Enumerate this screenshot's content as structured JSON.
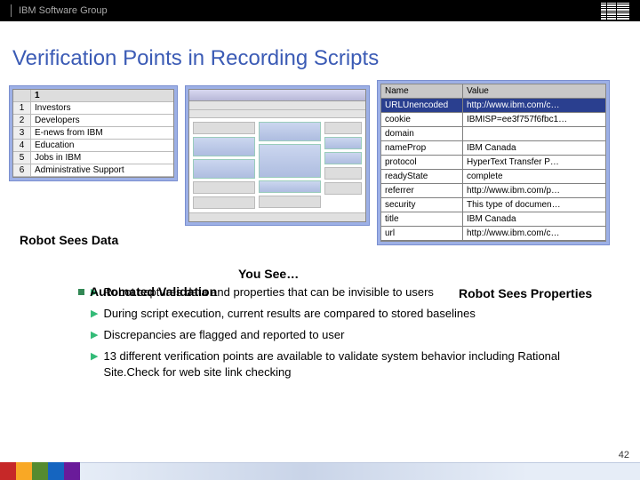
{
  "header": {
    "group": "IBM Software Group"
  },
  "title": "Verification Points in Recording Scripts",
  "captions": {
    "left": "Robot Sees Data",
    "mid": "You See…",
    "right": "Robot Sees Properties"
  },
  "sheet": {
    "head": "1",
    "rows": [
      {
        "n": "1",
        "v": "Investors"
      },
      {
        "n": "2",
        "v": "Developers"
      },
      {
        "n": "3",
        "v": "E-news from IBM"
      },
      {
        "n": "4",
        "v": "Education"
      },
      {
        "n": "5",
        "v": "Jobs in IBM"
      },
      {
        "n": "6",
        "v": "Administrative Support"
      }
    ]
  },
  "props": {
    "head_name": "Name",
    "head_value": "Value",
    "rows": [
      {
        "n": "URLUnencoded",
        "v": "http://www.ibm.com/c…",
        "sel": true
      },
      {
        "n": "cookie",
        "v": "IBMISP=ee3f757f6fbc1…"
      },
      {
        "n": "domain",
        "v": ""
      },
      {
        "n": "nameProp",
        "v": "IBM Canada"
      },
      {
        "n": "protocol",
        "v": "HyperText Transfer P…"
      },
      {
        "n": "readyState",
        "v": "complete"
      },
      {
        "n": "referrer",
        "v": "http://www.ibm.com/p…"
      },
      {
        "n": "security",
        "v": "This type of documen…"
      },
      {
        "n": "title",
        "v": "IBM Canada"
      },
      {
        "n": "url",
        "v": "http://www.ibm.com/c…"
      }
    ]
  },
  "section": {
    "head": "Automated Validation"
  },
  "bullets": [
    "Robot captures data and properties that can be invisible to users",
    "During script execution, current results are compared to stored baselines",
    "Discrepancies are flagged and reported to user",
    "13 different verification points are available to validate system behavior including Rational Site.Check for web site link checking"
  ],
  "page": "42"
}
